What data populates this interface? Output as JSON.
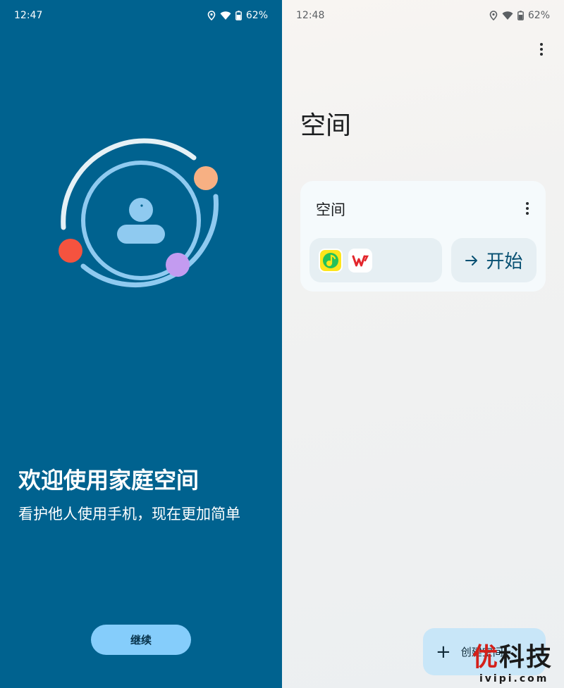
{
  "left": {
    "status": {
      "time": "12:47",
      "battery": "62%"
    },
    "title": "欢迎使用家庭空间",
    "subtitle": "看护他人使用手机，现在更加简单",
    "continue_label": "继续",
    "colors": {
      "background": "#00628f",
      "button": "#85cdfb"
    }
  },
  "right": {
    "status": {
      "time": "12:48",
      "battery": "62%"
    },
    "page_title": "空间",
    "card": {
      "title": "空间",
      "apps": [
        {
          "name": "qq-music-icon"
        },
        {
          "name": "wps-office-icon"
        }
      ],
      "start_label": "开始"
    },
    "fab_label": "创建空间",
    "colors": {
      "card": "#f5fafc",
      "fab": "#c8e6f8"
    }
  },
  "watermark": {
    "main_red": "优",
    "main": "科技",
    "sub": "ivipi.com"
  }
}
